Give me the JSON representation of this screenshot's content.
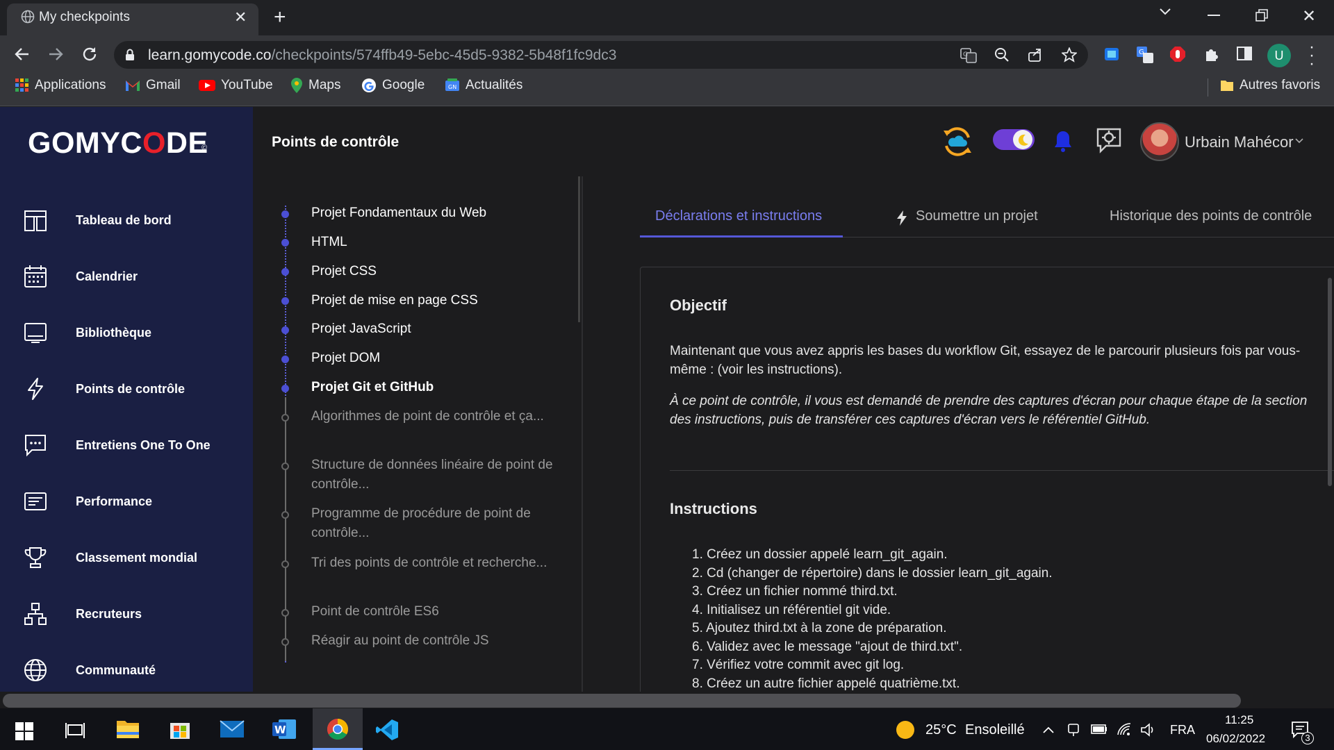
{
  "browser": {
    "tab_title": "My checkpoints",
    "url_host": "learn.gomycode.co",
    "url_path": "/checkpoints/574ffb49-5ebc-45d5-9382-5b48f1fc9dc3",
    "bookmarks": [
      {
        "label": "Applications",
        "icon": "apps-grid-icon"
      },
      {
        "label": "Gmail",
        "icon": "gmail-icon"
      },
      {
        "label": "YouTube",
        "icon": "youtube-icon"
      },
      {
        "label": "Maps",
        "icon": "maps-pin-icon"
      },
      {
        "label": "Google",
        "icon": "google-g-icon"
      },
      {
        "label": "Actualités",
        "icon": "news-icon"
      }
    ],
    "other_bookmarks": "Autres favoris",
    "profile_initial": "U"
  },
  "sidebar": {
    "logo_text": "GOMYC",
    "logo_o": "O",
    "logo_end": "DE",
    "logo_mark": "©",
    "items": [
      {
        "label": "Tableau de bord",
        "icon": "dashboard-icon"
      },
      {
        "label": "Calendrier",
        "icon": "calendar-icon"
      },
      {
        "label": "Bibliothèque",
        "icon": "library-icon"
      },
      {
        "label": "Points de contrôle",
        "icon": "lightning-icon"
      },
      {
        "label": "Entretiens One To One",
        "icon": "chat-icon"
      },
      {
        "label": "Performance",
        "icon": "performance-icon"
      },
      {
        "label": "Classement mondial",
        "icon": "trophy-icon"
      },
      {
        "label": "Recruteurs",
        "icon": "org-chart-icon"
      },
      {
        "label": "Communauté",
        "icon": "globe-icon"
      }
    ]
  },
  "header": {
    "page_title": "Points de contrôle",
    "user_name": "Urbain Mahécor"
  },
  "checkpoints": [
    {
      "label": "Projet Fondamentaux du Web",
      "status": "done"
    },
    {
      "label": "HTML",
      "status": "done"
    },
    {
      "label": "Projet CSS",
      "status": "done"
    },
    {
      "label": "Projet de mise en page CSS",
      "status": "done"
    },
    {
      "label": "Projet JavaScript",
      "status": "done"
    },
    {
      "label": "Projet DOM",
      "status": "done"
    },
    {
      "label": "Projet Git et GitHub",
      "status": "current"
    },
    {
      "label": "Algorithmes de point de contrôle et ça...",
      "status": "pending"
    },
    {
      "label": "Structure de données linéaire de point de contrôle...",
      "status": "pending"
    },
    {
      "label": "Programme de procédure de point de contrôle...",
      "status": "pending"
    },
    {
      "label": "Tri des points de contrôle et recherche...",
      "status": "pending"
    },
    {
      "label": "Point de contrôle ES6",
      "status": "pending"
    },
    {
      "label": "Réagir au point de contrôle JS",
      "status": "pending"
    }
  ],
  "tabs": {
    "declarations": "Déclarations et instructions",
    "submit": "Soumettre un projet",
    "history": "Historique des points de contrôle"
  },
  "content": {
    "objective_title": "Objectif",
    "objective_text": "Maintenant que vous avez appris les bases du workflow Git, essayez de le parcourir plusieurs fois par vous-même : (voir les instructions).",
    "objective_note": "À  ce point de contrôle, il vous est  demandé  de prendre des captures d'écran pour chaque étape de la section des instructions, puis de transférer ces captures d'écran vers le référentiel GitHub.",
    "instructions_title": "Instructions",
    "instructions": [
      "1. Créez un dossier appelé learn_git_again.",
      "2. Cd (changer de répertoire) dans le dossier learn_git_again.",
      "3. Créez un fichier nommé third.txt.",
      "4. Initialisez un référentiel git vide.",
      "5. Ajoutez third.txt à la zone de préparation.",
      "6. Validez avec le message \"ajout de third.txt\".",
      "7. Vérifiez votre commit avec git log.",
      "8. Créez un autre fichier appelé quatrième.txt."
    ]
  },
  "taskbar": {
    "weather_temp": "25°C",
    "weather_text": "Ensoleillé",
    "language": "FRA",
    "time": "11:25",
    "date": "06/02/2022",
    "notification_count": "3"
  },
  "colors": {
    "sidebar_bg": "#1a1f43",
    "accent": "#5558d8",
    "logo_red": "#e8202a"
  }
}
